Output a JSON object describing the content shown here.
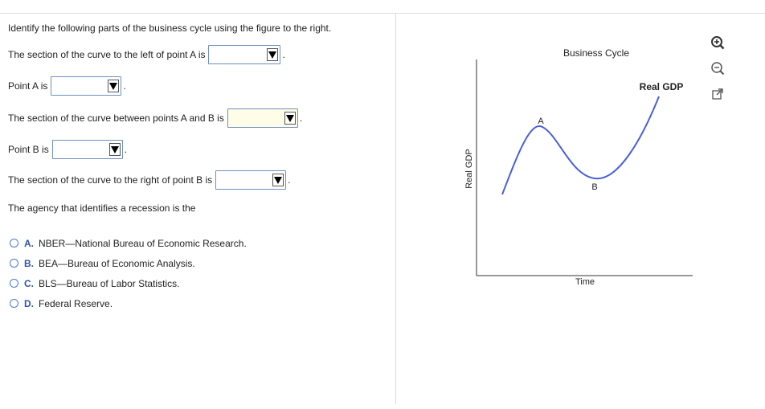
{
  "question": {
    "intro": "Identify the following parts of the business cycle using the figure to the right.",
    "items": [
      {
        "label": "The section of the curve to the left of point A is",
        "selected": "",
        "suffix": "."
      },
      {
        "label": "Point A is",
        "selected": "",
        "suffix": "."
      },
      {
        "label": "The section of the curve between points A and B is",
        "selected": "",
        "suffix": "."
      },
      {
        "label": "Point B is",
        "selected": "",
        "suffix": "."
      },
      {
        "label": "The section of the curve to the right of point B is",
        "selected": "",
        "suffix": "."
      }
    ],
    "agency_prompt": "The agency that identifies a recession is the",
    "options": [
      {
        "letter": "A.",
        "text": "NBER—National Bureau of Economic Research."
      },
      {
        "letter": "B.",
        "text": "BEA—Bureau of Economic Analysis."
      },
      {
        "letter": "C.",
        "text": "BLS—Bureau of Labor Statistics."
      },
      {
        "letter": "D.",
        "text": "Federal Reserve."
      }
    ]
  },
  "figure": {
    "title": "Business Cycle",
    "y_axis_label": "Real GDP",
    "x_axis_label": "Time",
    "curve_label": "Real GDP",
    "point_a": "A",
    "point_b": "B",
    "curve_color": "#4a5fd6"
  },
  "tools": [
    "zoom-in-icon",
    "zoom-out-icon",
    "open-new-window-icon"
  ]
}
